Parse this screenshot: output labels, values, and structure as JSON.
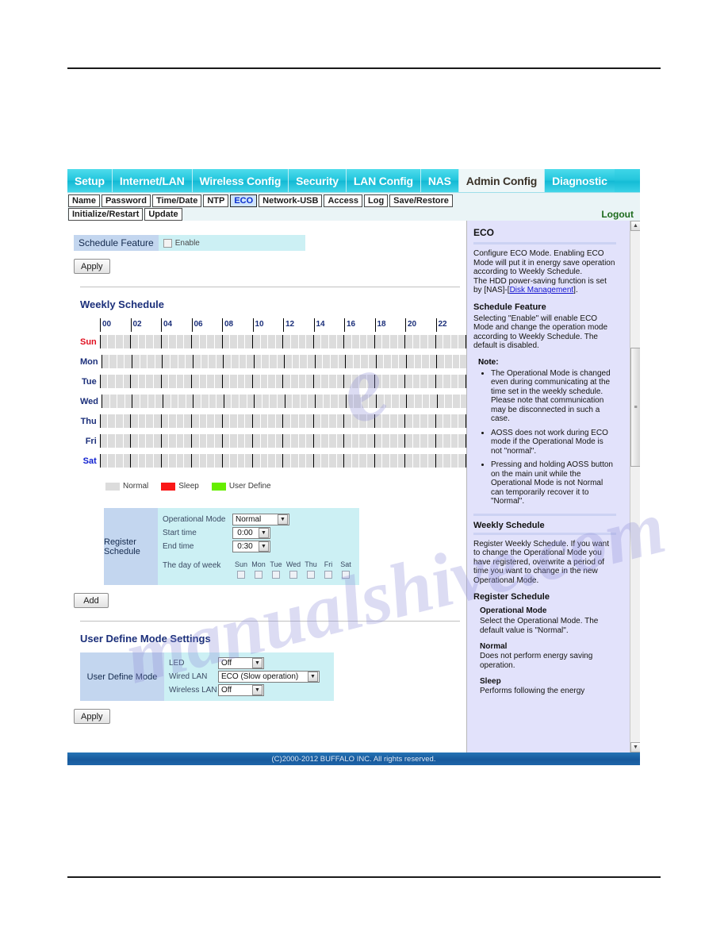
{
  "main_tabs": [
    {
      "label": "Setup",
      "active": false
    },
    {
      "label": "Internet/LAN",
      "active": false
    },
    {
      "label": "Wireless Config",
      "active": false
    },
    {
      "label": "Security",
      "active": false
    },
    {
      "label": "LAN Config",
      "active": false
    },
    {
      "label": "NAS",
      "active": false
    },
    {
      "label": "Admin Config",
      "active": true
    },
    {
      "label": "Diagnostic",
      "active": false
    }
  ],
  "sub_tabs_row1": [
    {
      "label": "Name",
      "active": false
    },
    {
      "label": "Password",
      "active": false
    },
    {
      "label": "Time/Date",
      "active": false
    },
    {
      "label": "NTP",
      "active": false
    },
    {
      "label": "ECO",
      "active": true
    },
    {
      "label": "Network-USB",
      "active": false
    },
    {
      "label": "Access",
      "active": false
    },
    {
      "label": "Log",
      "active": false
    },
    {
      "label": "Save/Restore",
      "active": false
    }
  ],
  "sub_tabs_row2": [
    {
      "label": "Initialize/Restart",
      "active": false
    },
    {
      "label": "Update",
      "active": false
    }
  ],
  "logout_label": "Logout",
  "schedule_feature": {
    "label": "Schedule Feature",
    "enable_label": "Enable",
    "enabled": false,
    "apply_label": "Apply"
  },
  "weekly_schedule": {
    "title": "Weekly Schedule",
    "hour_labels": [
      "00",
      "02",
      "04",
      "06",
      "08",
      "10",
      "12",
      "14",
      "16",
      "18",
      "20",
      "22"
    ],
    "days": [
      {
        "label": "Sun",
        "class": "d-sun"
      },
      {
        "label": "Mon",
        "class": "d-wk"
      },
      {
        "label": "Tue",
        "class": "d-wk"
      },
      {
        "label": "Wed",
        "class": "d-wk"
      },
      {
        "label": "Thu",
        "class": "d-wk"
      },
      {
        "label": "Fri",
        "class": "d-wk"
      },
      {
        "label": "Sat",
        "class": "d-sat"
      }
    ],
    "cells_per_day": 48,
    "legend": [
      {
        "label": "Normal",
        "color": "#dcdcdc",
        "swatch": "normal"
      },
      {
        "label": "Sleep",
        "color": "#fa1717",
        "swatch": "sleep"
      },
      {
        "label": "User Define",
        "color": "#66ee00",
        "swatch": "user"
      }
    ]
  },
  "register_schedule": {
    "box_label": "Register Schedule",
    "operational_mode_label": "Operational Mode",
    "operational_mode_value": "Normal",
    "start_time_label": "Start time",
    "start_time_value": "0:00",
    "end_time_label": "End time",
    "end_time_value": "0:30",
    "day_of_week_label": "The day of week",
    "days": [
      "Sun",
      "Mon",
      "Tue",
      "Wed",
      "Thu",
      "Fri",
      "Sat"
    ],
    "add_label": "Add"
  },
  "user_define": {
    "title": "User Define Mode Settings",
    "box_label": "User Define Mode",
    "rows": [
      {
        "key": "LED",
        "value": "Off",
        "width": "w-led"
      },
      {
        "key": "Wired LAN",
        "value": "ECO (Slow operation)",
        "width": "w-wan"
      },
      {
        "key": "Wireless LAN",
        "value": "Off",
        "width": "w-led"
      }
    ],
    "apply_label": "Apply"
  },
  "help": {
    "title": "ECO",
    "p1_a": "Configure ECO Mode. Enabling ECO Mode will put it in energy save operation according to Weekly Schedule.",
    "p1_b_pre": "The HDD power-saving function is set by [NAS]-[",
    "p1_link": "Disk Management",
    "p1_b_post": "].",
    "h_schedule_feature": "Schedule Feature",
    "p2": "Selecting \"Enable\" will enable ECO Mode and change the operation mode according to Weekly Schedule. The default is disabled.",
    "note_title": "Note:",
    "notes": [
      "The Operational Mode is changed even during communicating at the time set in the weekly schedule. Please note that communication may be disconnected in such a case.",
      "AOSS does not work during ECO mode if the Operational Mode is not \"normal\".",
      "Pressing and holding AOSS button on the main unit while the Operational Mode is not Normal can temporarily recover it to \"Normal\"."
    ],
    "h_weekly_schedule": "Weekly Schedule",
    "p3": "Register Weekly Schedule. If you want to change the Operational Mode you have registered, overwrite a period of time you want to change in the new Operational Mode.",
    "h_register_schedule": "Register Schedule",
    "h_operational_mode": "Operational Mode",
    "p4": "Select the Operational Mode. The default value is \"Normal\".",
    "h_normal": "Normal",
    "p5": "Does not perform energy saving operation.",
    "h_sleep": "Sleep",
    "p6": "Performs following the energy"
  },
  "footer": {
    "copyright": "(C)2000-2012 BUFFALO INC. All rights reserved."
  },
  "watermark": {
    "text1": "manualshive.com",
    "text2": "e"
  }
}
